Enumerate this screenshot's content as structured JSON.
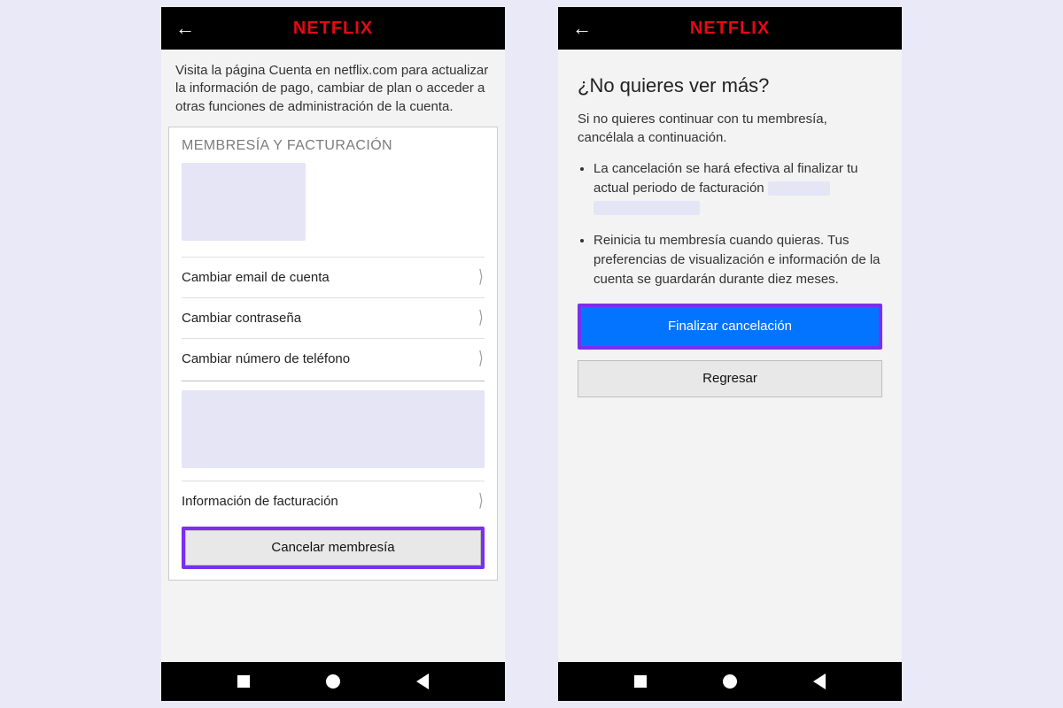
{
  "brand": "NETFLIX",
  "left": {
    "intro": "Visita la página Cuenta en netflix.com para actualizar la información de pago, cambiar de plan o acceder a otras funciones de administración de la cuenta.",
    "section_title": "MEMBRESÍA Y FACTURACIÓN",
    "rows": {
      "email": "Cambiar email de cuenta",
      "password": "Cambiar contraseña",
      "phone": "Cambiar número de teléfono",
      "billing": "Información de facturación"
    },
    "cancel_label": "Cancelar membresía"
  },
  "right": {
    "heading": "¿No quieres ver más?",
    "subtext": "Si no quieres continuar con tu membresía, cancélala a continuación.",
    "bullet1": "La cancelación se hará efectiva al finalizar tu actual periodo de facturación",
    "bullet2": "Reinicia tu membresía cuando quieras. Tus preferencias de visualización e información de la cuenta se guardarán durante diez meses.",
    "finish_label": "Finalizar cancelación",
    "return_label": "Regresar"
  }
}
